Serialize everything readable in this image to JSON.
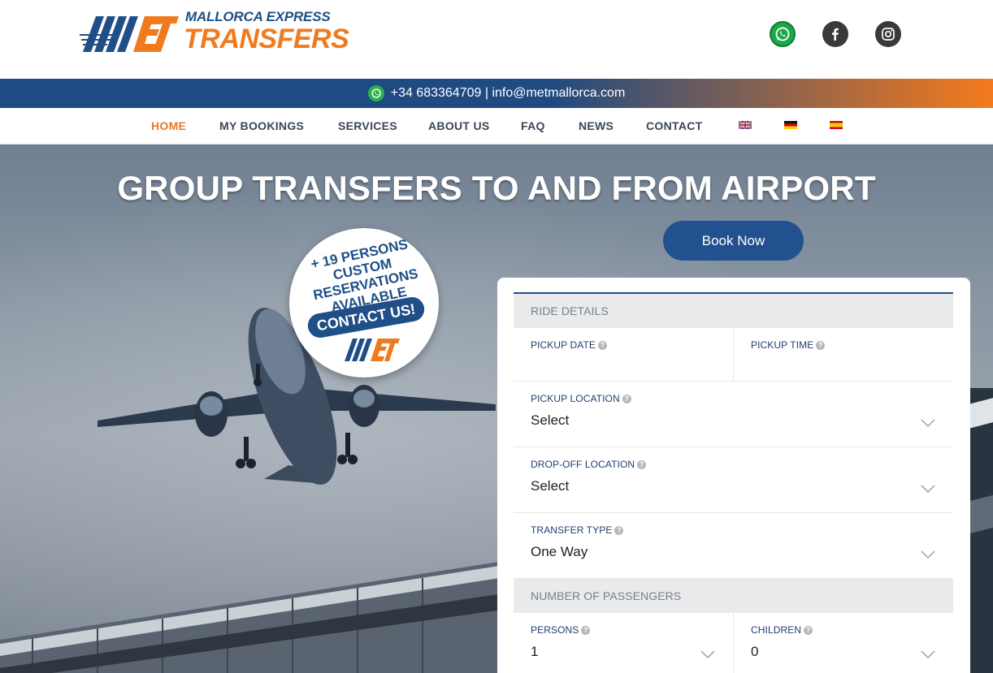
{
  "header": {
    "logo_line1_a": "MALLORCA ",
    "logo_line1_b": "EXPRESS",
    "logo_line2": "TRANSFERS",
    "social": [
      {
        "name": "whatsapp-icon",
        "color": "#1aa84a"
      },
      {
        "name": "facebook-icon",
        "color": "#3a3a3a"
      },
      {
        "name": "instagram-icon",
        "color": "#3a3a3a"
      }
    ]
  },
  "topbar": {
    "contact": "+34 683364709 | info@metmallorca.com"
  },
  "nav": {
    "items": [
      {
        "label": "HOME",
        "active": true
      },
      {
        "label": "MY BOOKINGS"
      },
      {
        "label": "SERVICES"
      },
      {
        "label": "ABOUT US"
      },
      {
        "label": "FAQ"
      },
      {
        "label": "NEWS"
      },
      {
        "label": "CONTACT"
      }
    ],
    "languages": [
      "uk-flag-icon",
      "germany-flag-icon",
      "spain-flag-icon"
    ]
  },
  "hero": {
    "title": "GROUP TRANSFERS TO AND FROM AIRPORT",
    "book_now": "Book Now",
    "badge_line1": "+ 19 PERSONS",
    "badge_line2": "CUSTOM",
    "badge_line3": "RESERVATIONS",
    "badge_line4": "AVAILABLE",
    "badge_contact": "CONTACT US!"
  },
  "form": {
    "ride_details": "RIDE DETAILS",
    "pickup_date_label": "PICKUP DATE",
    "pickup_date_value": "",
    "pickup_time_label": "PICKUP TIME",
    "pickup_time_value": "",
    "pickup_location_label": "PICKUP LOCATION",
    "pickup_location_value": "Select",
    "dropoff_location_label": "DROP-OFF LOCATION",
    "dropoff_location_value": "Select",
    "transfer_type_label": "TRANSFER TYPE",
    "transfer_type_value": "One Way",
    "passengers_head": "NUMBER OF PASSENGERS",
    "persons_label": "PERSONS",
    "persons_value": "1",
    "children_label": "CHILDREN",
    "children_value": "0"
  },
  "colors": {
    "brand_blue": "#1f4f86",
    "brand_orange": "#f07b1f"
  }
}
